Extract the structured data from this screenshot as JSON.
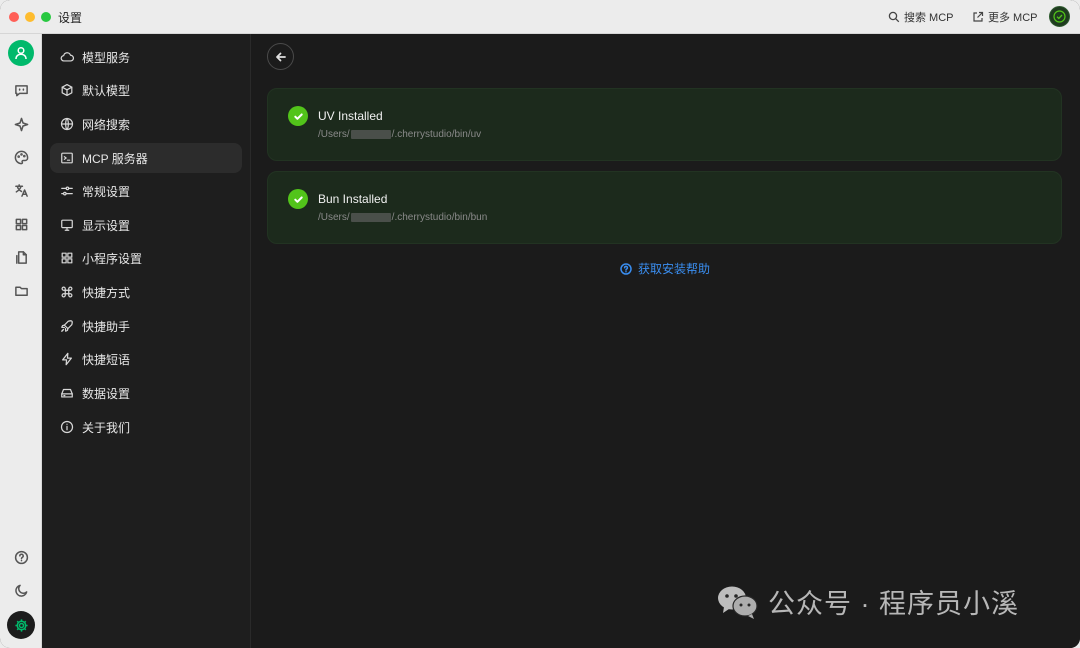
{
  "window": {
    "title": "设置"
  },
  "titlebar": {
    "search_mcp": "搜索 MCP",
    "more_mcp": "更多 MCP"
  },
  "rail": {
    "icons": [
      "user-avatar-icon",
      "chat-icon",
      "sparkle-icon",
      "palette-icon",
      "translate-icon",
      "apps-icon",
      "file-icon",
      "folder-icon",
      "help-icon",
      "moon-icon",
      "settings-icon"
    ]
  },
  "sidebar": {
    "items": [
      {
        "label": "模型服务",
        "icon": "cloud-icon"
      },
      {
        "label": "默认模型",
        "icon": "cube-icon"
      },
      {
        "label": "网络搜索",
        "icon": "globe-icon"
      },
      {
        "label": "MCP 服务器",
        "icon": "terminal-icon",
        "active": true
      },
      {
        "label": "常规设置",
        "icon": "sliders-icon"
      },
      {
        "label": "显示设置",
        "icon": "monitor-icon"
      },
      {
        "label": "小程序设置",
        "icon": "grid-icon"
      },
      {
        "label": "快捷方式",
        "icon": "command-icon"
      },
      {
        "label": "快捷助手",
        "icon": "rocket-icon"
      },
      {
        "label": "快捷短语",
        "icon": "bolt-icon"
      },
      {
        "label": "数据设置",
        "icon": "drive-icon"
      },
      {
        "label": "关于我们",
        "icon": "info-icon"
      }
    ]
  },
  "main": {
    "cards": [
      {
        "title": "UV Installed",
        "path_prefix": "/Users/",
        "path_suffix": "/.cherrystudio/bin/uv"
      },
      {
        "title": "Bun Installed",
        "path_prefix": "/Users/",
        "path_suffix": "/.cherrystudio/bin/bun"
      }
    ],
    "help_link": "获取安装帮助"
  },
  "watermark": {
    "text": "公众号 · 程序员小溪"
  },
  "colors": {
    "accent": "#00b96b",
    "success": "#52c41a",
    "link": "#3a8ef0",
    "card_bg": "#1c2a1c"
  }
}
